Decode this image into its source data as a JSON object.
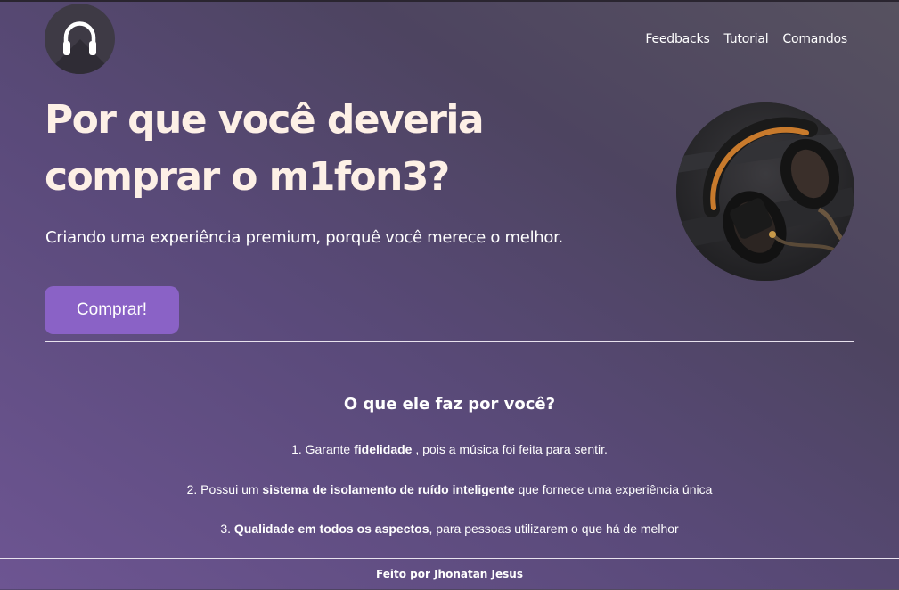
{
  "nav": {
    "links": [
      "Feedbacks",
      "Tutorial",
      "Comandos"
    ]
  },
  "hero": {
    "title_line1": "Por que você deveria",
    "title_line2": "comprar o m1fon3?",
    "subtitle": "Criando uma experiência premium, porquê você merece o melhor.",
    "buy_label": "Comprar!"
  },
  "features": {
    "heading": "O que ele faz por você?",
    "items": [
      {
        "prefix": "1. Garante ",
        "bold": "fidelidade",
        "suffix": " , pois a música foi feita para sentir."
      },
      {
        "prefix": "2. Possui um ",
        "bold": "sistema de isolamento de ruído inteligente",
        "suffix": " que fornece uma experiência única"
      },
      {
        "prefix": "3. ",
        "bold": "Qualidade em todos os aspectos",
        "suffix": ", para pessoas utilizarem o que há de melhor"
      }
    ]
  },
  "footer": {
    "text": "Feito por Jhonatan Jesus"
  },
  "icons": {
    "logo": "headphones-icon",
    "product_image": "headphones-photo"
  },
  "colors": {
    "accent": "#8a62c6",
    "text": "#fff2ea"
  }
}
